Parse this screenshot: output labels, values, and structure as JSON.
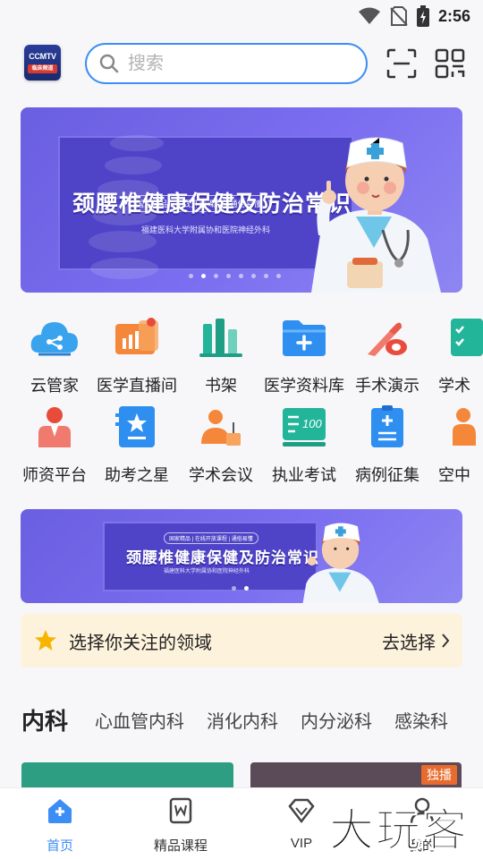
{
  "status": {
    "time": "2:56"
  },
  "header": {
    "logo": {
      "line1": "CCMTV",
      "line2": "临床频道"
    },
    "search_placeholder": "搜索"
  },
  "banner": {
    "tag": "国家精品 | 在线开放课程 | 通俗易懂",
    "title": "颈腰椎健康保健及防治常识",
    "subtitle": "福建医科大学附属协和医院神经外科",
    "slide_count": 8,
    "active_slide": 2
  },
  "banner2": {
    "tag": "国家精品 | 在线开放课程 | 通俗易懂",
    "title": "颈腰椎健康保健及防治常识",
    "subtitle": "福建医科大学附属协和医院神经外科",
    "slide_count": 2,
    "active_slide": 2
  },
  "grid_row1": [
    {
      "label": "云管家",
      "icon": "cloud-icon"
    },
    {
      "label": "医学直播间",
      "icon": "live-icon"
    },
    {
      "label": "书架",
      "icon": "bookshelf-icon"
    },
    {
      "label": "医学资料库",
      "icon": "folder-icon"
    },
    {
      "label": "手术演示",
      "icon": "scalpel-icon"
    },
    {
      "label": "学术",
      "icon": "checklist-icon"
    }
  ],
  "grid_row2": [
    {
      "label": "师资平台",
      "icon": "teacher-icon"
    },
    {
      "label": "助考之星",
      "icon": "star-card-icon"
    },
    {
      "label": "学术会议",
      "icon": "conference-icon"
    },
    {
      "label": "执业考试",
      "icon": "exam-board-icon"
    },
    {
      "label": "病例征集",
      "icon": "clipboard-icon"
    },
    {
      "label": "空中",
      "icon": "person-icon"
    }
  ],
  "prompt": {
    "text": "选择你关注的领域",
    "action": "去选择"
  },
  "tabs": [
    "内科",
    "心血管内科",
    "消化内科",
    "内分泌科",
    "感染科"
  ],
  "card_badge": "独播",
  "bottom_nav": [
    {
      "label": "首页",
      "icon": "home-icon"
    },
    {
      "label": "精品课程",
      "icon": "course-icon"
    },
    {
      "label": "VIP",
      "icon": "diamond-icon"
    },
    {
      "label": "我的",
      "icon": "profile-icon"
    }
  ],
  "watermark": "大玩客",
  "colors": {
    "accent": "#3d8ef4",
    "banner": "#6a5fe0",
    "prompt_bg": "#fdf3dd"
  }
}
